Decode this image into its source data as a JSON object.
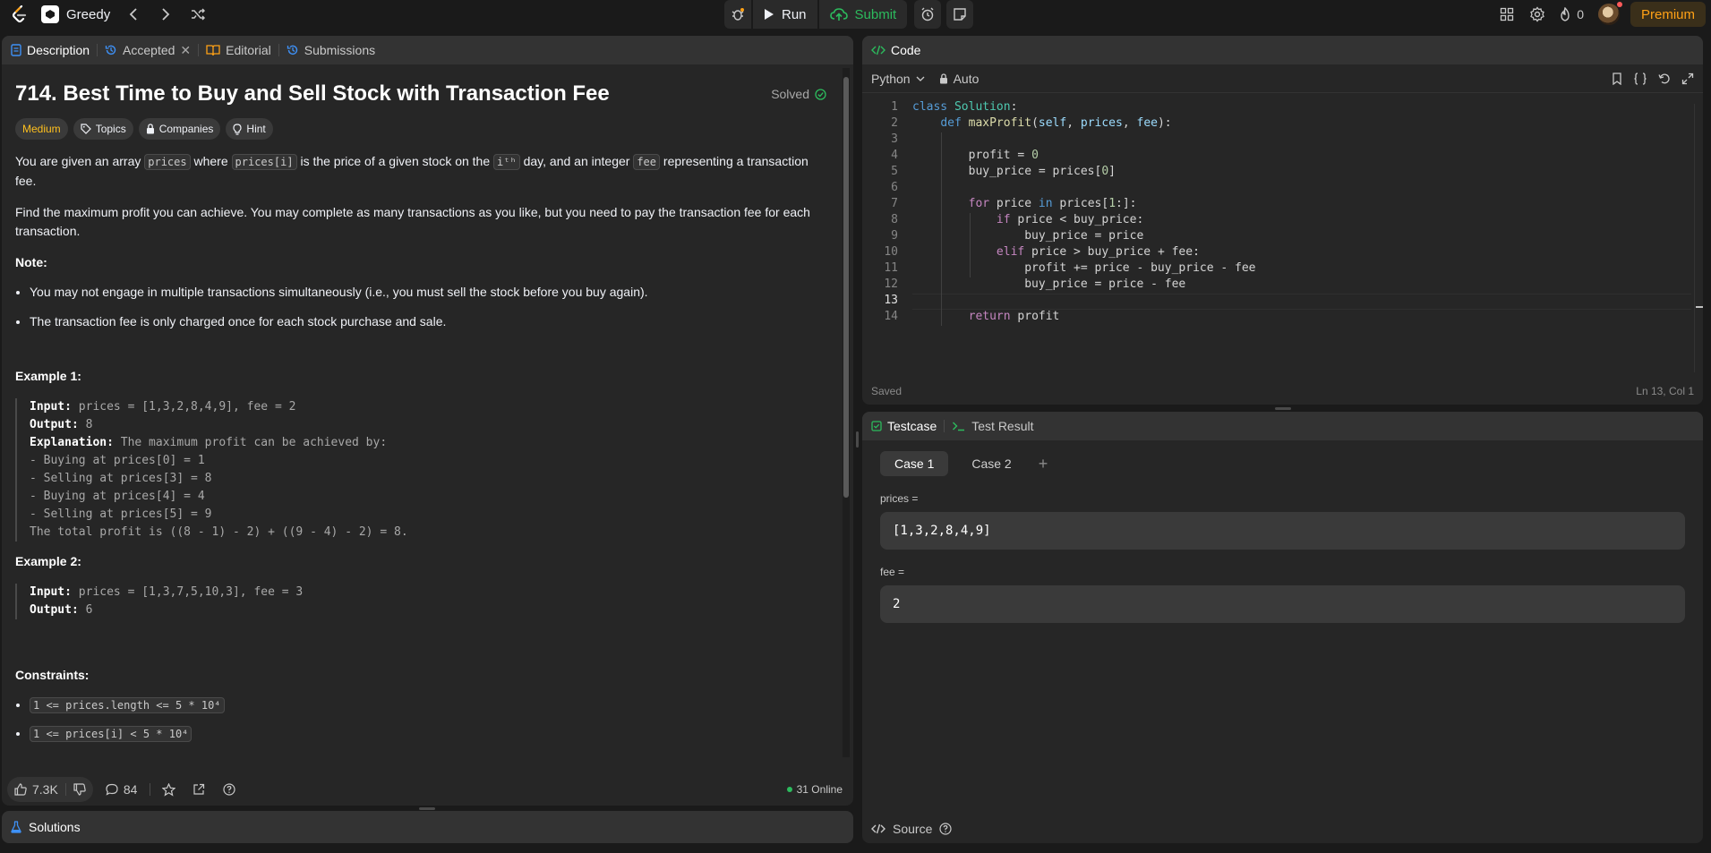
{
  "topbar": {
    "list_title": "Greedy",
    "run_label": "Run",
    "submit_label": "Submit",
    "streak": "0",
    "premium_label": "Premium"
  },
  "desc": {
    "tabs": [
      "Description",
      "Accepted",
      "Editorial",
      "Submissions"
    ],
    "title": "714. Best Time to Buy and Sell Stock with Transaction Fee",
    "solved": "Solved",
    "tags": [
      "Medium",
      "Topics",
      "Companies",
      "Hint"
    ],
    "p1_a": "You are given an array ",
    "p1_code1": "prices",
    "p1_b": " where ",
    "p1_code2": "prices[i]",
    "p1_c": " is the price of a given stock on the ",
    "p1_code3": "iᵗʰ",
    "p1_d": " day, and an integer ",
    "p1_code4": "fee",
    "p1_e": " representing a transaction fee.",
    "p2": "Find the maximum profit you can achieve. You may complete as many transactions as you like, but you need to pay the transaction fee for each transaction.",
    "note_label": "Note:",
    "notes": [
      "You may not engage in multiple transactions simultaneously (i.e., you must sell the stock before you buy again).",
      "The transaction fee is only charged once for each stock purchase and sale."
    ],
    "ex1_title": "Example 1:",
    "ex1": {
      "input_label": "Input:",
      "input": " prices = [1,3,2,8,4,9], fee = 2",
      "output_label": "Output:",
      "output": " 8",
      "expl_label": "Explanation:",
      "expl": " The maximum profit can be achieved by:",
      "lines": [
        "- Buying at prices[0] = 1",
        "- Selling at prices[3] = 8",
        "- Buying at prices[4] = 4",
        "- Selling at prices[5] = 9",
        "The total profit is ((8 - 1) - 2) + ((9 - 4) - 2) = 8."
      ]
    },
    "ex2_title": "Example 2:",
    "ex2": {
      "input_label": "Input:",
      "input": " prices = [1,3,7,5,10,3], fee = 3",
      "output_label": "Output:",
      "output": " 6"
    },
    "constraints_label": "Constraints:",
    "constraints": [
      "1 <= prices.length <= 5 * 10⁴",
      "1 <= prices[i] < 5 * 10⁴"
    ],
    "likes": "7.3K",
    "comments": "84",
    "online": "31 Online"
  },
  "solutions_label": "Solutions",
  "code": {
    "tab": "Code",
    "language": "Python",
    "auto": "Auto",
    "saved": "Saved",
    "cursor": "Ln 13, Col 1",
    "line_numbers": [
      "1",
      "2",
      "3",
      "4",
      "5",
      "6",
      "7",
      "8",
      "9",
      "10",
      "11",
      "12",
      "13",
      "14"
    ]
  },
  "test": {
    "tabs": [
      "Testcase",
      "Test Result"
    ],
    "cases": [
      "Case 1",
      "Case 2"
    ],
    "fields": [
      {
        "label": "prices =",
        "value": "[1,3,2,8,4,9]"
      },
      {
        "label": "fee =",
        "value": "2"
      }
    ],
    "source": "Source"
  }
}
